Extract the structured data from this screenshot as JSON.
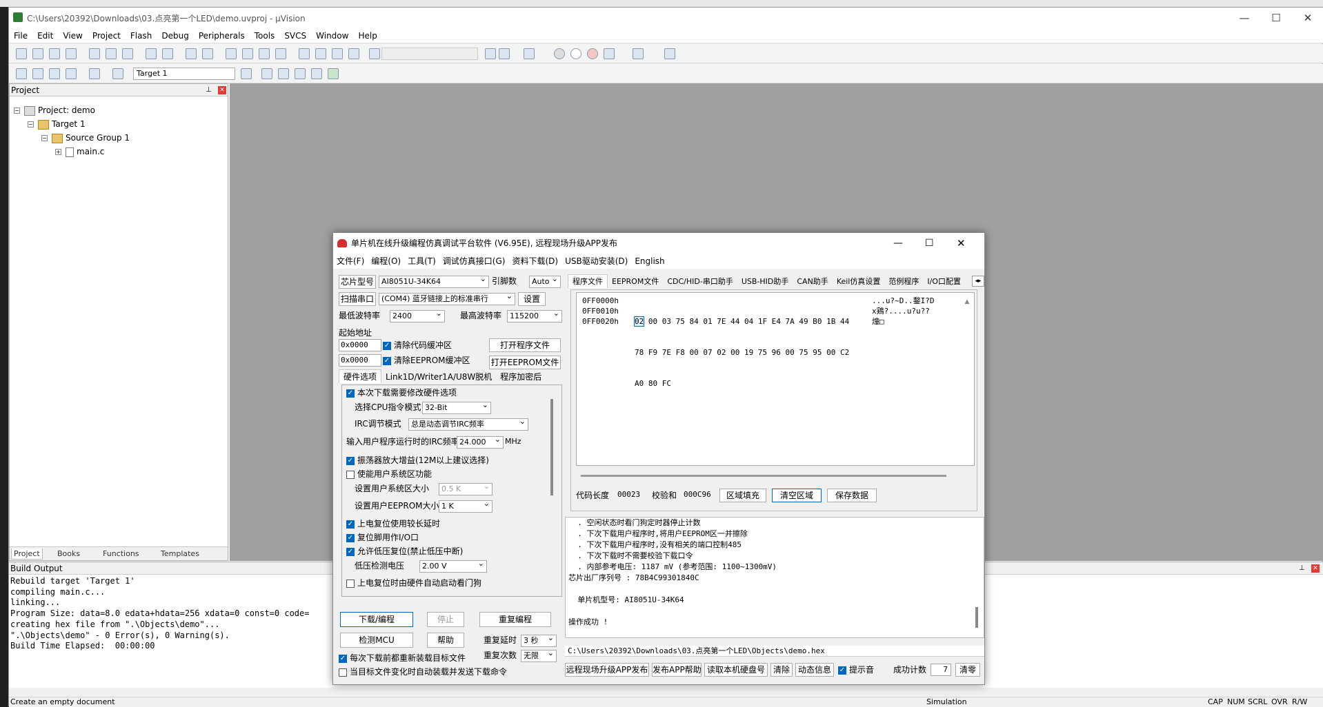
{
  "window": {
    "title": "C:\\Users\\20392\\Downloads\\03.点亮第一个LED\\demo.uvproj - µVision"
  },
  "menus": [
    "File",
    "Edit",
    "View",
    "Project",
    "Flash",
    "Debug",
    "Peripherals",
    "Tools",
    "SVCS",
    "Window",
    "Help"
  ],
  "toolbar": {
    "target": "Target 1"
  },
  "project": {
    "panel_title": "Project",
    "root": "Project: demo",
    "target": "Target 1",
    "group": "Source Group 1",
    "file": "main.c",
    "tabs": [
      "Project",
      "Books",
      "Functions",
      "Templates"
    ]
  },
  "build": {
    "title": "Build Output",
    "lines": [
      "Rebuild target 'Target 1'",
      "compiling main.c...",
      "linking...",
      "Program Size: data=8.0 edata+hdata=256 xdata=0 const=0 code=",
      "creating hex file from \".\\Objects\\demo\"...",
      "\".\\Objects\\demo\" - 0 Error(s), 0 Warning(s).",
      "Build Time Elapsed:  00:00:00"
    ]
  },
  "status": {
    "left": "Create an empty document",
    "mode": "Simulation",
    "keys": [
      "CAP",
      "NUM",
      "SCRL",
      "OVR",
      "R/W"
    ]
  },
  "stc": {
    "title": "单片机在线升级编程仿真调试平台软件 (V6.95E), 远程现场升级APP发布",
    "menus": [
      "文件(F)",
      "编程(O)",
      "工具(T)",
      "调试仿真接口(G)",
      "资料下载(D)",
      "USB驱动安装(D)",
      "English"
    ],
    "chip_label": "芯片型号",
    "chip_value": "AI8051U-34K64",
    "pins_label": "引脚数",
    "pins_value": "Auto",
    "scan_label": "扫描串口",
    "port_value": "(COM4) 蓝牙链接上的标准串行",
    "settings_label": "设置",
    "min_baud_label": "最低波特率",
    "min_baud": "2400",
    "max_baud_label": "最高波特率",
    "max_baud": "115200",
    "start_addr_label": "起始地址",
    "addr1": "0x0000",
    "addr2": "0x0000",
    "clear_code_label": "清除代码缓冲区",
    "clear_eeprom_label": "清除EEPROM缓冲区",
    "open_prog_label": "打开程序文件",
    "open_eeprom_label": "打开EEPROM文件",
    "left_tabs": [
      "硬件选项",
      "Link1D/Writer1A/U8W脱机",
      "程序加密后"
    ],
    "hw": {
      "modify_hw": "本次下载需要修改硬件选项",
      "cpu_mode_label": "选择CPU指令模式",
      "cpu_mode": "32-Bit",
      "irc_mode_label": "IRC调节模式",
      "irc_mode": "总是动态调节IRC频率",
      "irc_freq_label": "输入用户程序运行时的IRC频率",
      "irc_freq": "24.000",
      "irc_unit": "MHz",
      "osc_gain": "振荡器放大增益(12M以上建议选择)",
      "user_sys": "使能用户系统区功能",
      "sys_size_label": "设置用户系统区大小",
      "sys_size": "0.5 K",
      "eeprom_size_label": "设置用户EEPROM大小",
      "eeprom_size": "1   K",
      "long_reset": "上电复位使用较长延时",
      "reset_io": "复位脚用作I/O口",
      "low_volt_reset": "允许低压复位(禁止低压中断)",
      "low_volt_label": "低压检测电压",
      "low_volt": "2.00 V",
      "wdt": "上电复位时由硬件自动启动看门狗"
    },
    "download_btn": "下载/编程",
    "stop_btn": "停止",
    "reprogram_btn": "重复编程",
    "detect_btn": "检测MCU",
    "help_btn": "帮助",
    "repeat_delay_label": "重复延时",
    "repeat_delay": "3 秒",
    "repeat_count_label": "重复次数",
    "repeat_count": "无限",
    "reload_label": "每次下载前都重新装载目标文件",
    "auto_send_label": "当目标文件变化时自动装载并发送下载命令",
    "right_tabs": [
      "程序文件",
      "EEPROM文件",
      "CDC/HID-串口助手",
      "USB-HID助手",
      "CAN助手",
      "Keil仿真设置",
      "范例程序",
      "I/O口配置"
    ],
    "hex": {
      "addrs": [
        "0FF0000h",
        "0FF0010h",
        "0FF0020h"
      ],
      "first_byte": "02",
      "rows": [
        "00 03 75 84 01 7E 44 04 1F E4 7A 49 B0 1B 44",
        "78 F9 7E F8 00 07 02 00 19 75 96 00 75 95 00 C2",
        "A0 80 FC"
      ],
      "ascii": [
        "...u?~D..鍪I?D",
        "x鶏?....u?u??",
        "燑□"
      ]
    },
    "code_len_label": "代码长度",
    "code_len": "00023",
    "checksum_label": "校验和",
    "checksum": "000C96",
    "fill_btn": "区域填充",
    "clear_btn": "清空区域",
    "save_btn": "保存数据",
    "log": [
      "  . 空闲状态时看门狗定时器停止计数",
      "  . 下次下载用户程序时,将用户EEPROM区一并擦除",
      "  . 下次下载用户程序时,没有相关的端口控制485",
      "  . 下次下载时不需要校验下载口令",
      "  . 内部参考电压: 1187 mV (参考范围: 1100~1300mV)",
      "芯片出厂序列号 : 78B4C99301840C",
      "",
      "  单片机型号: AI8051U-34K64",
      "",
      "操作成功 !"
    ],
    "file_path": "C:\\Users\\20392\\Downloads\\03.点亮第一个LED\\Objects\\demo.hex",
    "bottom": {
      "publish_btn": "远程现场升级APP发布",
      "publish_help_btn": "发布APP帮助",
      "read_disk_btn": "读取本机硬盘号",
      "clear_btn": "清除",
      "dynamic_btn": "动态信息",
      "beep_label": "提示音",
      "success_label": "成功计数",
      "success_count": "7",
      "reset_btn": "清零"
    }
  }
}
